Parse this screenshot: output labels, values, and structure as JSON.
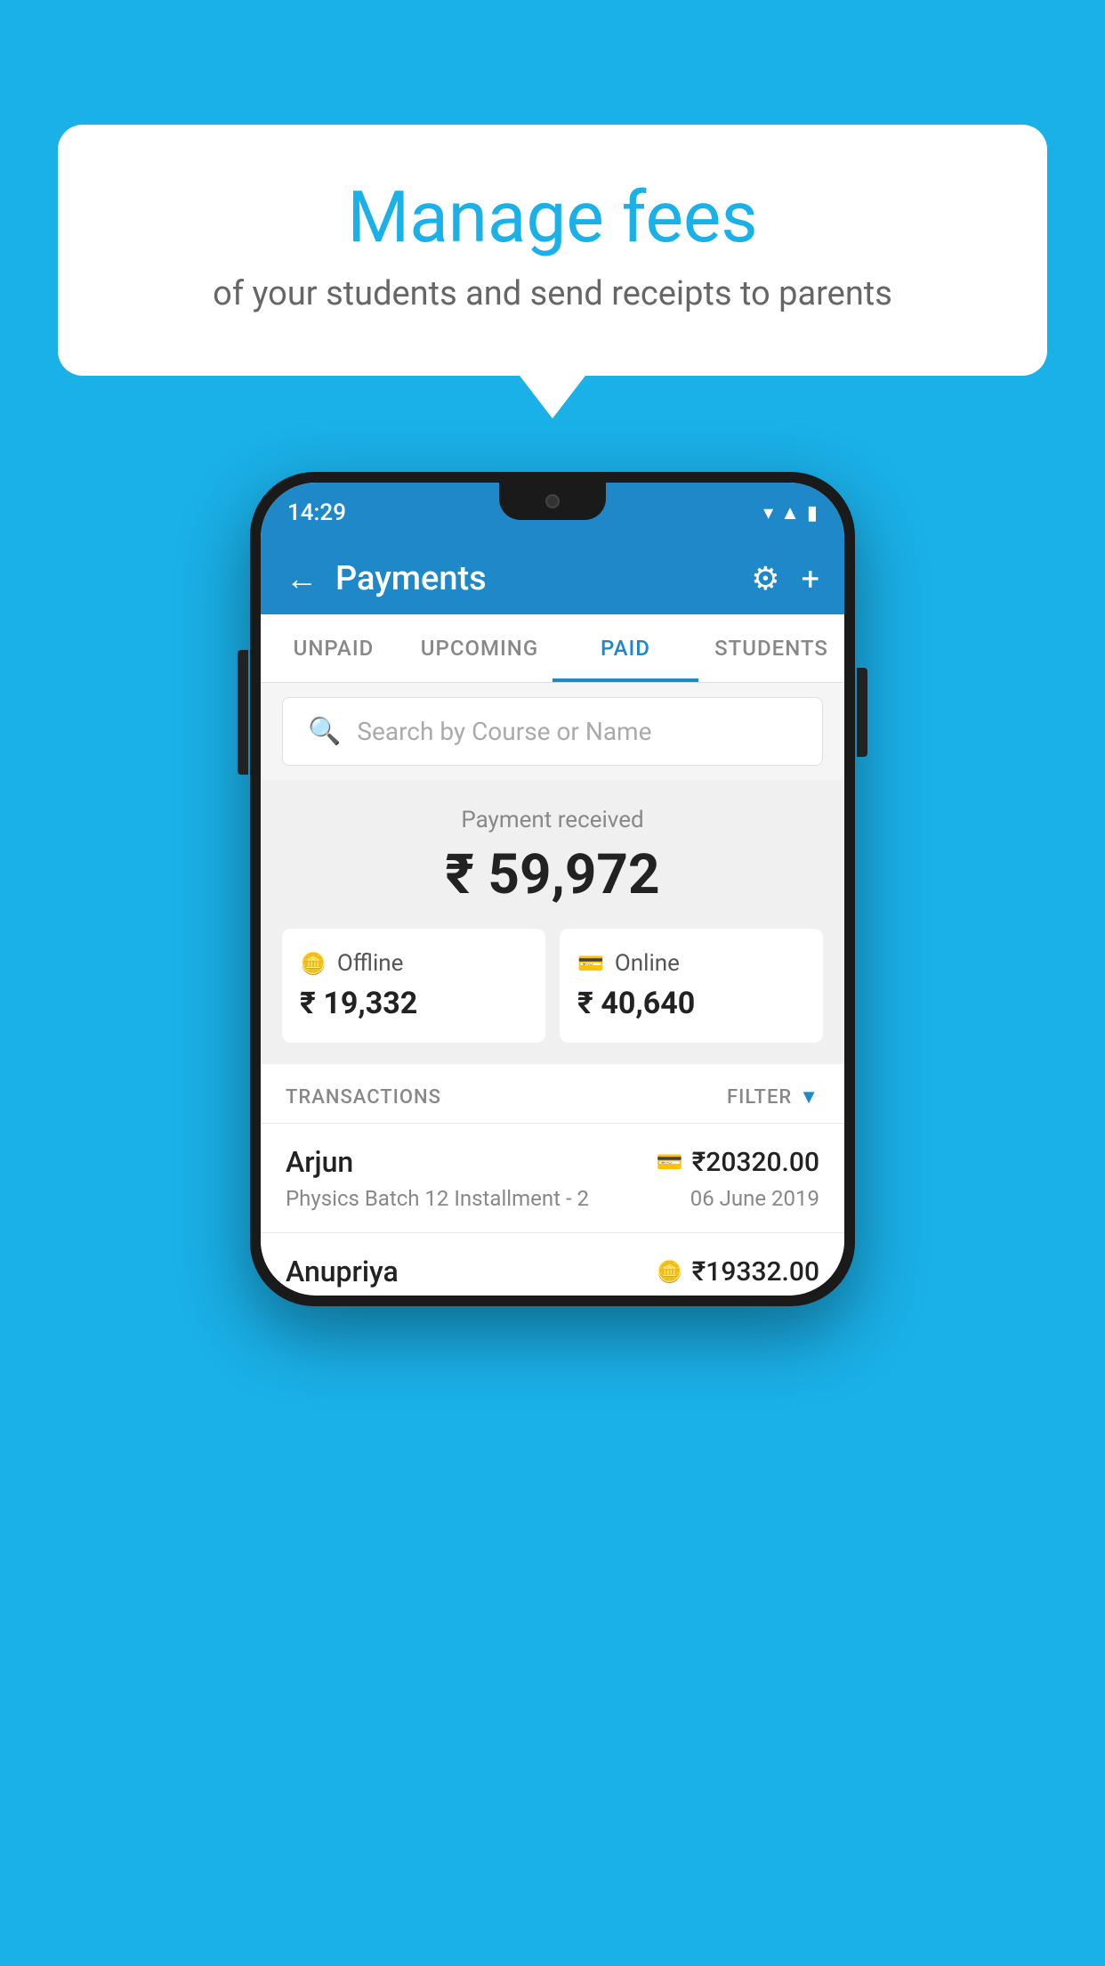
{
  "background_color": "#1ab0e8",
  "speech_bubble": {
    "title": "Manage fees",
    "subtitle": "of your students and send receipts to parents"
  },
  "phone": {
    "status_bar": {
      "time": "14:29",
      "icons": [
        "wifi",
        "signal",
        "battery"
      ]
    },
    "header": {
      "title": "Payments",
      "back_label": "←",
      "settings_label": "⚙",
      "add_label": "+"
    },
    "tabs": [
      {
        "label": "UNPAID",
        "active": false
      },
      {
        "label": "UPCOMING",
        "active": false
      },
      {
        "label": "PAID",
        "active": true
      },
      {
        "label": "STUDENTS",
        "active": false
      }
    ],
    "search": {
      "placeholder": "Search by Course or Name"
    },
    "payment_received": {
      "label": "Payment received",
      "amount": "₹ 59,972",
      "offline": {
        "label": "Offline",
        "amount": "₹ 19,332"
      },
      "online": {
        "label": "Online",
        "amount": "₹ 40,640"
      }
    },
    "transactions": {
      "header_label": "TRANSACTIONS",
      "filter_label": "FILTER",
      "rows": [
        {
          "name": "Arjun",
          "course": "Physics Batch 12 Installment - 2",
          "amount": "₹20320.00",
          "date": "06 June 2019",
          "payment_type": "online"
        },
        {
          "name": "Anupriya",
          "course": "",
          "amount": "₹19332.00",
          "date": "",
          "payment_type": "offline"
        }
      ]
    }
  }
}
